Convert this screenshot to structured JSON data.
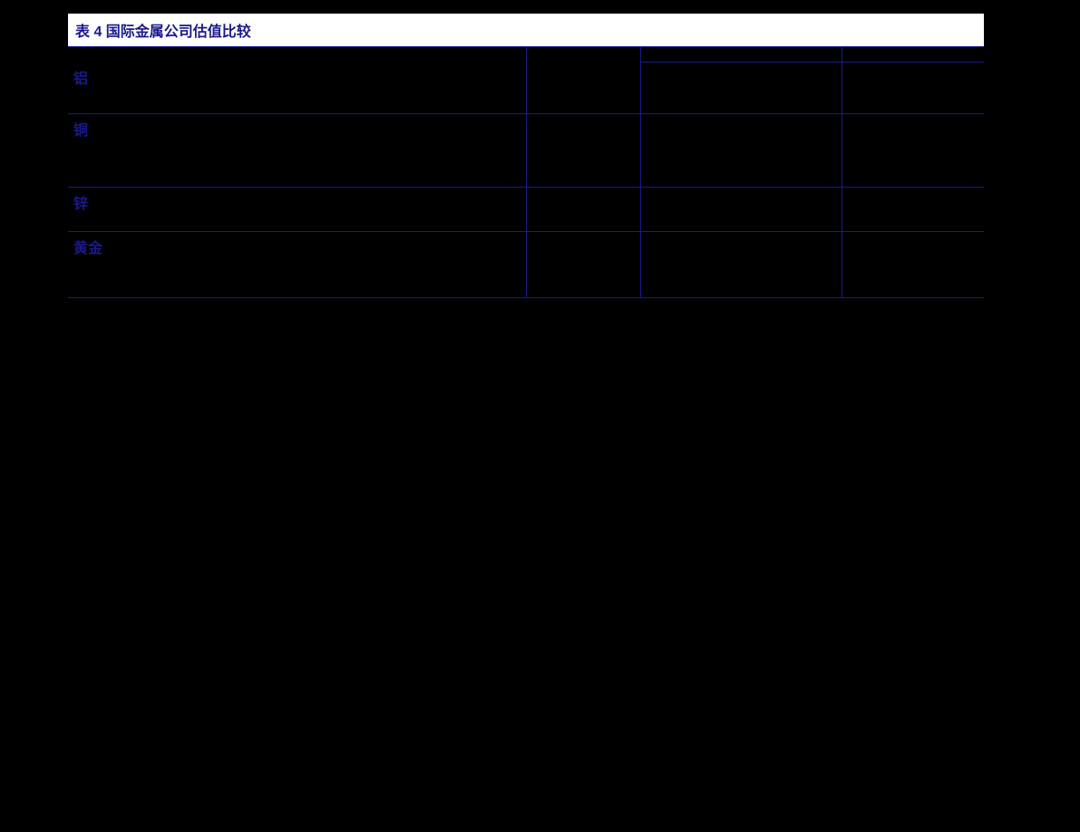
{
  "title": "表 4  国际金属公司估值比较",
  "header": {
    "col1": "",
    "col2": "",
    "col3_a": "",
    "col3_b": "",
    "col4_a": "",
    "col4_b": ""
  },
  "sections": [
    {
      "label": "铝",
      "rows": [
        {
          "name": "",
          "v1": "",
          "v2": "",
          "v3": ""
        },
        {
          "name": "",
          "v1": "",
          "v2": "",
          "v3": ""
        },
        {
          "name": "",
          "v1": "",
          "v2": "",
          "v3": ""
        },
        {
          "name": "",
          "v1": "",
          "v2": "",
          "v3": ""
        }
      ]
    },
    {
      "label": "铜",
      "rows": [
        {
          "name": "",
          "v1": "",
          "v2": "",
          "v3": ""
        },
        {
          "name": "",
          "v1": "",
          "v2": "",
          "v3": ""
        },
        {
          "name": "",
          "v1": "",
          "v2": "",
          "v3": ""
        },
        {
          "name": "",
          "v1": "",
          "v2": "",
          "v3": ""
        },
        {
          "name": "",
          "v1": "",
          "v2": "",
          "v3": ""
        },
        {
          "name": "",
          "v1": "",
          "v2": "",
          "v3": ""
        },
        {
          "name": "",
          "v1": "",
          "v2": "",
          "v3": ""
        }
      ]
    },
    {
      "label": "锌",
      "rows": [
        {
          "name": "",
          "v1": "",
          "v2": "",
          "v3": ""
        },
        {
          "name": "",
          "v1": "",
          "v2": "",
          "v3": ""
        },
        {
          "name": "",
          "v1": "",
          "v2": "",
          "v3": ""
        }
      ]
    },
    {
      "label": "黄金",
      "rows": [
        {
          "name": "",
          "v1": "",
          "v2": "",
          "v3": ""
        },
        {
          "name": "",
          "v1": "",
          "v2": "",
          "v3": ""
        },
        {
          "name": "",
          "v1": "",
          "v2": "",
          "v3": ""
        },
        {
          "name": "",
          "v1": "",
          "v2": "",
          "v3": ""
        },
        {
          "name": "",
          "v1": "",
          "v2": "",
          "v3": ""
        },
        {
          "name": "",
          "v1": "",
          "v2": "",
          "v3": ""
        }
      ]
    }
  ]
}
